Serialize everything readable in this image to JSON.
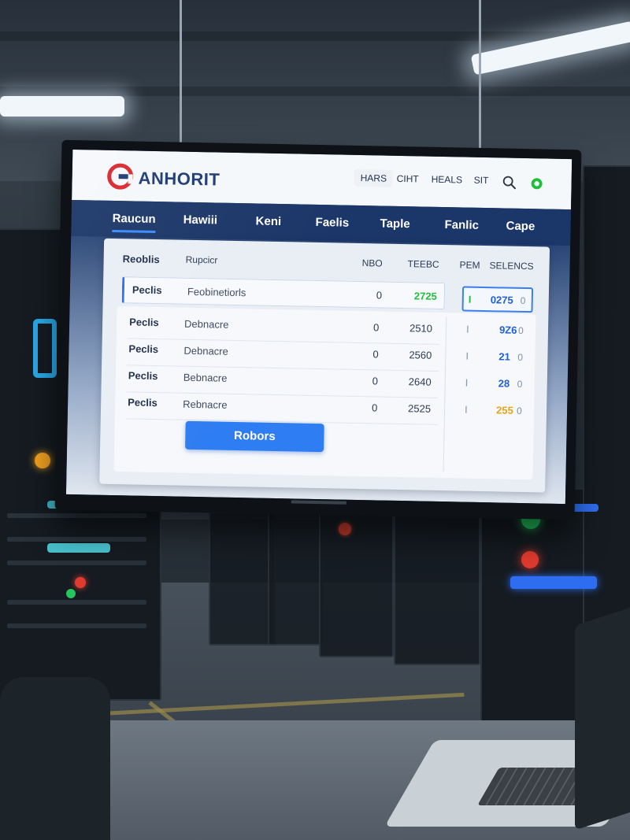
{
  "app": {
    "brand": "ANHORIT",
    "header_nav": [
      {
        "label": "HARS",
        "active": true
      },
      {
        "label": "CIHT",
        "active": false
      },
      {
        "label": "HEALS",
        "active": false
      },
      {
        "label": "SIT",
        "active": false
      }
    ],
    "icons": {
      "logo": "brand-logo-icon",
      "search": "search-icon",
      "status": "status-online-icon"
    },
    "colors": {
      "navy": "#1b3668",
      "accent": "#2f7df2",
      "green": "#1fbf3a",
      "gold": "#e5a21b"
    }
  },
  "tabs": [
    {
      "label": "Raucun",
      "active": true
    },
    {
      "label": "Hawiii",
      "active": false
    },
    {
      "label": "Keni",
      "active": false
    },
    {
      "label": "Faelis",
      "active": false
    },
    {
      "label": "Taple",
      "active": false
    },
    {
      "label": "Fanlic",
      "active": false
    },
    {
      "label": "Cape",
      "active": false
    }
  ],
  "table": {
    "headers": {
      "name": "Reoblis",
      "description": "Rupcicr",
      "col1": "NBO",
      "col2": "TEEBC",
      "col3": "PEM",
      "col4": "SELENCS"
    },
    "selected_row": {
      "name": "Peclis",
      "description": "Feobinetiorls",
      "col1": "0",
      "col2": "2725",
      "col3": "I",
      "col4": "0275",
      "col5": "0"
    },
    "rows": [
      {
        "name": "Peclis",
        "description": "Debnacre",
        "col1": "0",
        "col2": "2510",
        "col3": "I",
        "col4": "9Z6",
        "col5": "0"
      },
      {
        "name": "Peclis",
        "description": "Debnacre",
        "col1": "0",
        "col2": "2560",
        "col3": "I",
        "col4": "21",
        "col5": "0"
      },
      {
        "name": "Peclis",
        "description": "Bebnacre",
        "col1": "0",
        "col2": "2640",
        "col3": "I",
        "col4": "28",
        "col5": "0"
      },
      {
        "name": "Peclis",
        "description": "Rebnacre",
        "col1": "0",
        "col2": "2525",
        "col3": "I",
        "col4": "255",
        "col5": "0"
      }
    ]
  },
  "actions": {
    "primary_label": "Robors"
  }
}
